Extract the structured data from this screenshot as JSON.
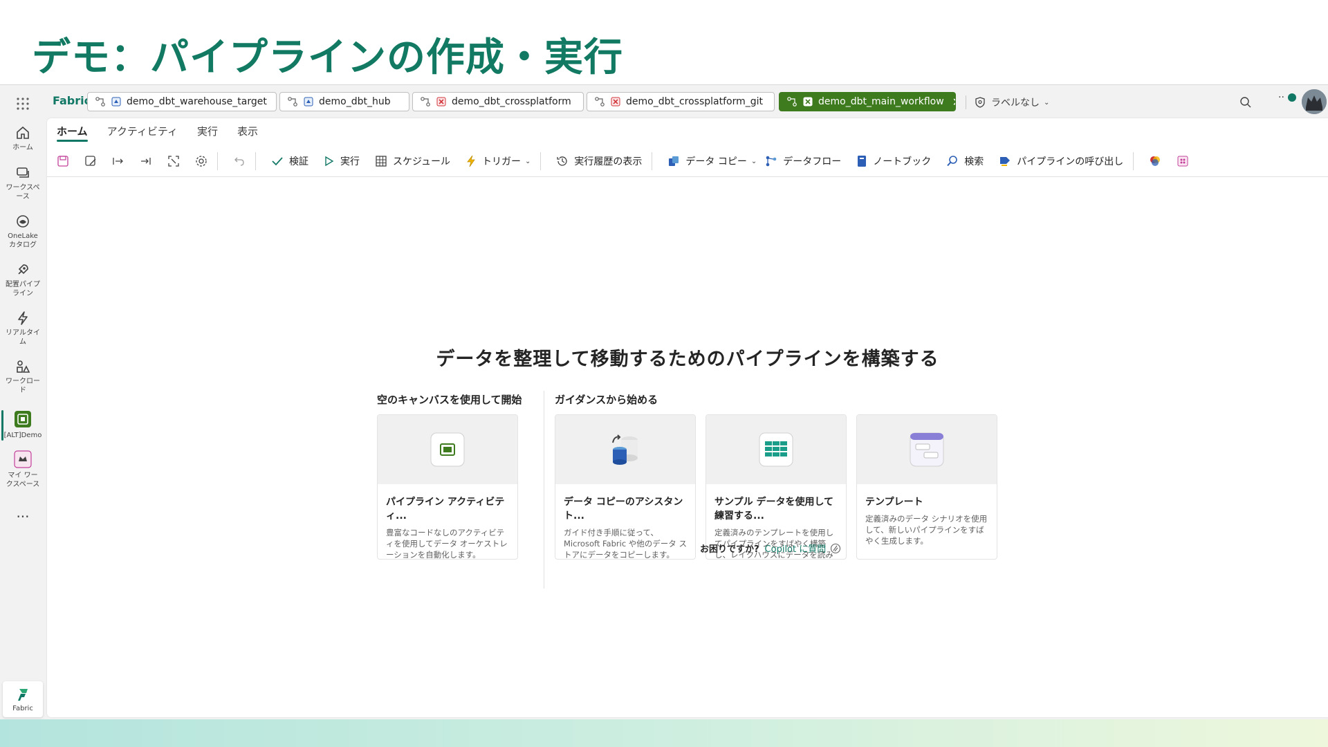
{
  "slide": {
    "title": "デモ：パイプラインの作成・実行"
  },
  "app": {
    "brand": "Fabric",
    "tabs": [
      {
        "label": "demo_dbt_warehouse_target",
        "active": false
      },
      {
        "label": "demo_dbt_hub",
        "active": false
      },
      {
        "label": "demo_dbt_crossplatform",
        "active": false
      },
      {
        "label": "demo_dbt_crossplatform_git",
        "active": false
      },
      {
        "label": "demo_dbt_main_workflow",
        "active": true
      }
    ],
    "label_control": "ラベルなし",
    "rail": [
      {
        "label": "ホーム",
        "icon": "home-icon"
      },
      {
        "label": "ワークスペース",
        "icon": "workspaces-icon"
      },
      {
        "label": "OneLake カタログ",
        "icon": "onelake-icon"
      },
      {
        "label": "配置パイプライン",
        "icon": "deployment-pipeline-icon"
      },
      {
        "label": "リアルタイム",
        "icon": "realtime-icon"
      },
      {
        "label": "ワークロード",
        "icon": "workload-icon"
      },
      {
        "label": "[ALT]Demo",
        "icon": "workspace-alt-demo-icon"
      },
      {
        "label": "マイ ワークスペース",
        "icon": "my-workspace-icon"
      }
    ],
    "rail_more": "...",
    "rail_fabric": "Fabric",
    "menu_tabs": [
      "ホーム",
      "アクティビティ",
      "実行",
      "表示"
    ],
    "toolbar": {
      "validate": "検証",
      "run": "実行",
      "schedule": "スケジュール",
      "trigger": "トリガー",
      "history": "実行履歴の表示",
      "copy_data": "データ コピー",
      "dataflow": "データフロー",
      "notebook": "ノートブック",
      "lookup": "検索",
      "invoke_pipeline": "パイプラインの呼び出し"
    },
    "canvas": {
      "hero": "データを整理して移動するためのパイプラインを構築する",
      "section_blank": "空のキャンバスを使用して開始",
      "section_guided": "ガイダンスから始める",
      "cards": [
        {
          "title": "パイプライン アクティビティ...",
          "desc": "豊富なコードなしのアクティビティを使用してデータ オーケストレーションを自動化します。"
        },
        {
          "title": "データ コピーのアシスタント...",
          "desc": "ガイド付き手順に従って、Microsoft Fabric や他のデータ ストアにデータをコピーします。"
        },
        {
          "title": "サンプル データを使用して練習する...",
          "desc": "定義済みのテンプレートを使用してパイプラインをすばやく構築し、レイクハウスにデータを読み込みます。"
        },
        {
          "title": "テンプレート",
          "desc": "定義済みのデータ シナリオを使用して、新しいパイプラインをすばやく生成します。"
        }
      ],
      "help_question": "お困りですか?",
      "help_link": "Copilot に質問"
    }
  }
}
